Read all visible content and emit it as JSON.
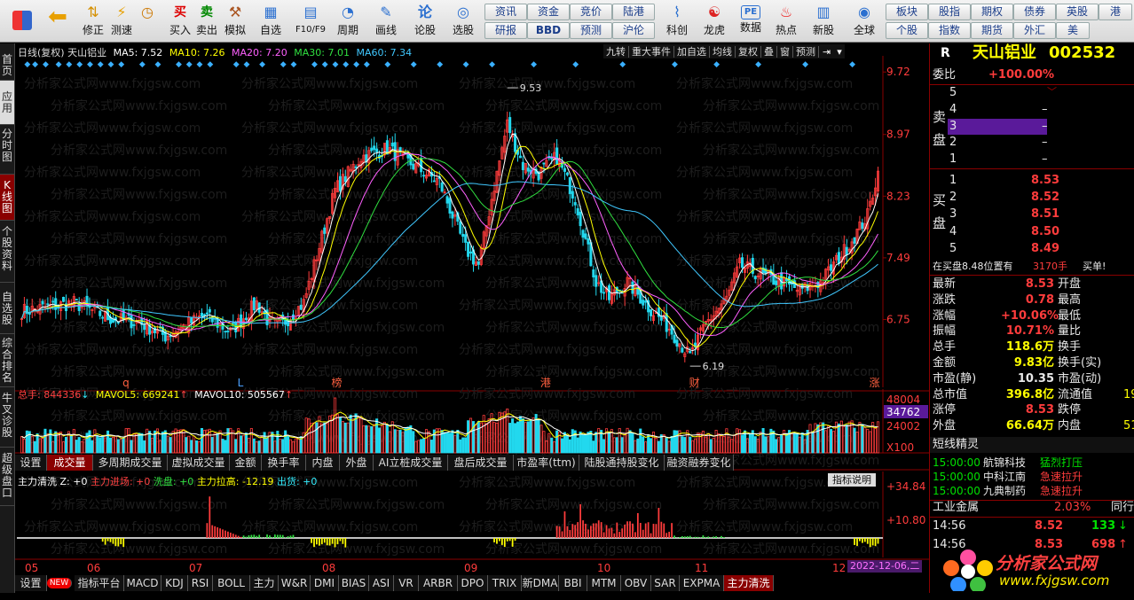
{
  "toolbar": {
    "left_items": [
      {
        "label": "",
        "icon": "home-grid-icon"
      },
      {
        "label": "",
        "icon": "back-arrow-icon"
      },
      {
        "label": "修正",
        "icon": "updown-icon"
      },
      {
        "label": "测速",
        "icon": "lightning-icon"
      },
      {
        "label": "",
        "icon": "clock-icon"
      },
      {
        "label": "买入",
        "icon": "buy-icon",
        "glyph": "买"
      },
      {
        "label": "卖出",
        "icon": "sell-icon",
        "glyph": "卖"
      },
      {
        "label": "模拟",
        "icon": "hammer-icon"
      },
      {
        "label": "自选",
        "icon": "star-icon"
      },
      {
        "label": "F10/F9",
        "icon": "document-icon"
      },
      {
        "label": "周期",
        "icon": "period-icon"
      },
      {
        "label": "画线",
        "icon": "pencil-icon"
      },
      {
        "label": "论股",
        "icon": "talk-icon"
      },
      {
        "label": "选股",
        "icon": "search-stock-icon"
      }
    ],
    "mid_buttons_row1": [
      "资讯",
      "资金",
      "竞价",
      "陆港"
    ],
    "mid_buttons_row2": [
      "研报",
      "BBD",
      "预测",
      "沪伦"
    ],
    "right_items": [
      {
        "label": "科创",
        "icon": "sci-icon"
      },
      {
        "label": "龙虎",
        "icon": "dragon-tiger-icon"
      },
      {
        "label": "数据",
        "icon": "pe-icon"
      },
      {
        "label": "热点",
        "icon": "hot-icon"
      },
      {
        "label": "新股",
        "icon": "new-stock-icon"
      },
      {
        "label": "全球",
        "icon": "globe-icon"
      }
    ],
    "far_row1": [
      "板块",
      "股指",
      "期权",
      "债券",
      "英股",
      "港"
    ],
    "far_row2": [
      "个股",
      "指数",
      "期货",
      "外汇",
      "美"
    ],
    "zixuan": "自选",
    "f10": "F10/F9"
  },
  "left_nav": [
    {
      "label": "首页",
      "active": false
    },
    {
      "label": "应用",
      "active": false
    },
    {
      "label": "分时图",
      "active": false
    },
    {
      "label": "K线图",
      "active": true
    },
    {
      "label": "个股资料",
      "active": false
    },
    {
      "label": "自选股",
      "active": false
    },
    {
      "label": "综合排名",
      "active": false
    },
    {
      "label": "牛叉诊股",
      "active": false
    },
    {
      "label": "超级盘口",
      "active": false
    }
  ],
  "header": {
    "title": "日线(复权)  天山铝业",
    "ma5": "MA5: 7.52",
    "ma10": "MA10: 7.26",
    "ma20": "MA20: 7.20",
    "ma30": "MA30: 7.01",
    "ma60": "MA60: 7.34",
    "toolbar_labels": [
      "九转",
      "重大事件",
      "加自选",
      "均线",
      "复权",
      "叠",
      "窗",
      "预测"
    ]
  },
  "price_axis": [
    "9.72",
    "8.97",
    "8.23",
    "7.49",
    "6.75"
  ],
  "price_annotations": {
    "high": "9.53",
    "low": "6.19"
  },
  "event_marks": [
    "q",
    "L",
    "榜",
    "港",
    "财",
    "涨"
  ],
  "vol_header": {
    "total": "总手: 844336",
    "mavol5": "MAVOL5: 669241",
    "mavol10": "MAVOL10: 505567"
  },
  "vol_axis": [
    "48004",
    "34762",
    "24002",
    "X100"
  ],
  "tabs1": [
    "设置",
    "成交量",
    "多周期成交量",
    "虚拟成交量",
    "金额",
    "换手率",
    "内盘",
    "外盘",
    "AI立桩成交量",
    "盘后成交量",
    "市盈率(ttm)",
    "陆股通持股变化",
    "融资融券变化"
  ],
  "ind_header": {
    "name": "主力清洗",
    "z": "Z: +0",
    "entry": "主力进场: +0",
    "wash": "洗盘: +0",
    "pull": "主力拉高: -12.19",
    "out": "出货: +0",
    "explain": "指标说明"
  },
  "ind_axis": [
    "+34.84",
    "+10.80"
  ],
  "months": [
    "05",
    "06",
    "07",
    "08",
    "09",
    "10",
    "11",
    "12"
  ],
  "cur_date": "2022-12-06,二",
  "tabs2": [
    "设置",
    "NEW",
    "指标平台",
    "MACD",
    "KDJ",
    "RSI",
    "BOLL",
    "主力",
    "W&R",
    "DMI",
    "BIAS",
    "ASI",
    "VR",
    "ARBR",
    "DPO",
    "TRIX",
    "新DMA",
    "BBI",
    "MTM",
    "OBV",
    "SAR",
    "EXPMA",
    "主力清洗"
  ],
  "watermark": "分析家公式网www.fxjgsw.com",
  "right_panel": {
    "R": "R",
    "stock_name": "天山铝业",
    "stock_code": "002532",
    "weibi_label": "委比",
    "weibi_value": "+100.00%",
    "sell_label": "卖盘",
    "buy_label": "买盘",
    "sell": [
      {
        "n": "5",
        "p": "",
        "v": ""
      },
      {
        "n": "4",
        "p": "–",
        "v": ""
      },
      {
        "n": "3",
        "p": "–",
        "v": ""
      },
      {
        "n": "2",
        "p": "–",
        "v": ""
      },
      {
        "n": "1",
        "p": "–",
        "v": ""
      }
    ],
    "buy": [
      {
        "n": "1",
        "p": "8.53"
      },
      {
        "n": "2",
        "p": "8.52"
      },
      {
        "n": "3",
        "p": "8.51"
      },
      {
        "n": "4",
        "p": "8.50"
      },
      {
        "n": "5",
        "p": "8.49"
      }
    ],
    "buy_notice": "在买盘8.48位置有",
    "buy_notice_vol": "3170手",
    "buy_notice_tag": "买单!",
    "quotes_left": [
      {
        "k": "最新",
        "v": "8.53"
      },
      {
        "k": "涨跌",
        "v": "0.78"
      },
      {
        "k": "涨幅",
        "v": "+10.06%"
      },
      {
        "k": "振幅",
        "v": "10.71%"
      },
      {
        "k": "总手",
        "v": "118.6万"
      },
      {
        "k": "金额",
        "v": "9.83亿"
      },
      {
        "k": "市盈(静)",
        "v": "10.35"
      },
      {
        "k": "总市值",
        "v": "396.8亿"
      },
      {
        "k": "涨停",
        "v": "8.53"
      },
      {
        "k": "外盘",
        "v": "66.64万"
      }
    ],
    "quotes_right": [
      "开盘",
      "最高",
      "最低",
      "量比",
      "换手",
      "换手(实)",
      "市盈(动)",
      "流通值",
      "跌停",
      "内盘"
    ],
    "quotes_right_vals": [
      "",
      "",
      "",
      "",
      "",
      "",
      "",
      "19",
      "",
      "51"
    ],
    "short_title": "短线精灵",
    "short_items": [
      {
        "t": "15:00:00",
        "n": "航锦科技",
        "e": "猛烈打压"
      },
      {
        "t": "15:00:00",
        "n": "中科江南",
        "e": "急速拉升"
      },
      {
        "t": "15:00:00",
        "n": "九典制药",
        "e": "急速拉升"
      }
    ],
    "industry": "工业金属",
    "industry_chg": "2.03%",
    "industry_peer": "同行",
    "ticks": [
      {
        "t": "14:56",
        "p": "8.52",
        "v": "133"
      },
      {
        "t": "14:56",
        "p": "8.53",
        "v": "698"
      }
    ],
    "logo_text": "分析家公式网",
    "logo_url": "www.fxjgsw.com"
  }
}
